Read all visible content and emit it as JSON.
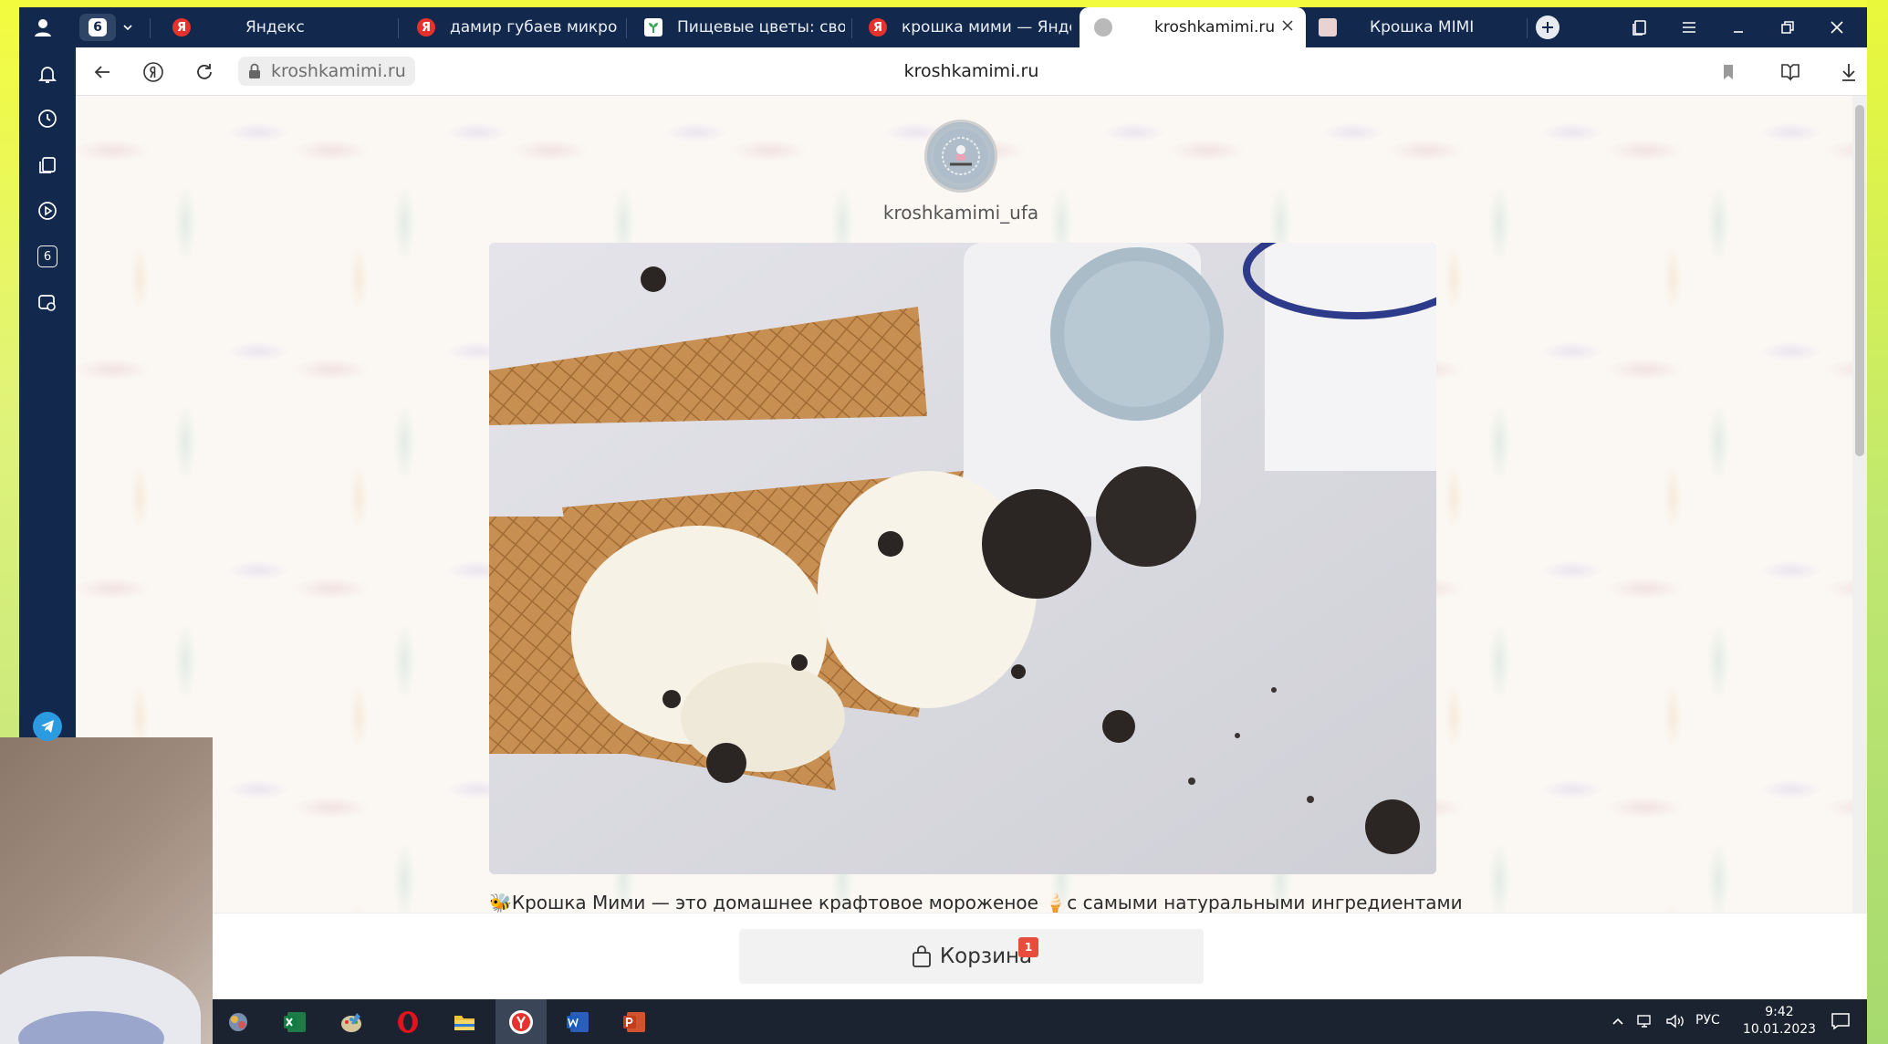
{
  "browser": {
    "profile_badge": "6",
    "tabs": [
      {
        "label": "Яндекс",
        "favicon_letter": "Я",
        "favicon_color": "#e5322d"
      },
      {
        "label": "дамир губаев микрозеле",
        "favicon_letter": "Я",
        "favicon_color": "#e5322d"
      },
      {
        "label": "Пищевые цветы: свойств",
        "favicon_letter": "",
        "favicon_color": "#3aa655"
      },
      {
        "label": "крошка мими — Яндекс:",
        "favicon_letter": "Я",
        "favicon_color": "#e5322d"
      },
      {
        "label": "kroshkamimi.ru",
        "favicon_letter": "",
        "favicon_color": "#b9b9b9"
      },
      {
        "label": "Крошка MIMI",
        "favicon_letter": "",
        "favicon_color": "#d8a7a7"
      }
    ],
    "active_tab": 4,
    "url": "kroshkamimi.ru",
    "page_title": "kroshkamimi.ru",
    "sidebar_counter": "6"
  },
  "page": {
    "username": "kroshkamimi_ufa",
    "description": "🐝Крошка Мими — это домашнее крафтовое мороженое 🍦с самыми натуральными ингредиентами",
    "cart_label": "Корзина",
    "cart_count": "1",
    "colors": {
      "accent_badge": "#e74c3c",
      "chrome_dark": "#12294d",
      "taskbar": "#1b2330"
    }
  },
  "taskbar": {
    "apps": [
      "pinned-app-icon",
      "excel-icon",
      "paint-icon",
      "opera-icon",
      "explorer-icon",
      "yandex-browser-icon",
      "word-icon",
      "powerpoint-icon"
    ],
    "language": "РУС",
    "time": "9:42",
    "date": "10.01.2023"
  }
}
